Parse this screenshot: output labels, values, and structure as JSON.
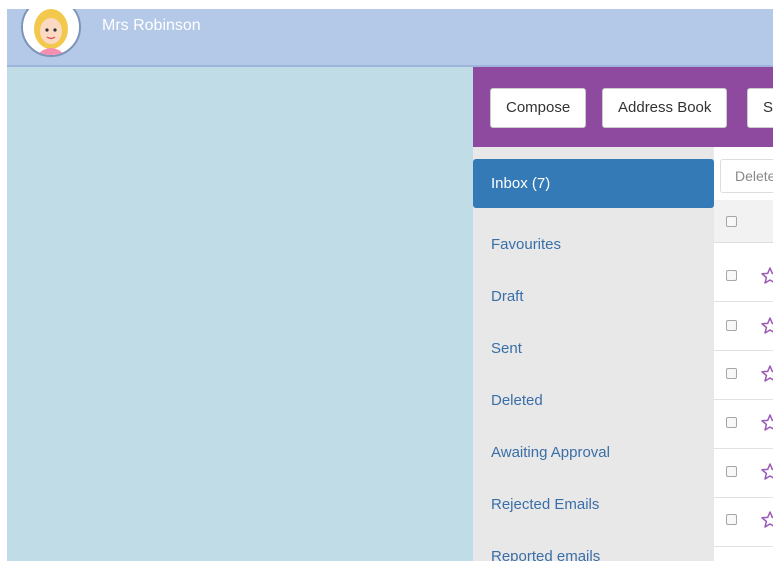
{
  "header": {
    "user_name": "Mrs Robinson"
  },
  "toolbar": {
    "compose_label": "Compose",
    "address_book_label": "Address Book",
    "third_label": "S"
  },
  "sidebar": {
    "items": [
      {
        "label": "Inbox (7)",
        "active": true
      },
      {
        "label": "Favourites",
        "active": false
      },
      {
        "label": "Draft",
        "active": false
      },
      {
        "label": "Sent",
        "active": false
      },
      {
        "label": "Deleted",
        "active": false
      },
      {
        "label": "Awaiting Approval",
        "active": false
      },
      {
        "label": "Rejected Emails",
        "active": false
      },
      {
        "label": "Reported emails",
        "active": false
      }
    ]
  },
  "message_list": {
    "delete_label": "Delete"
  },
  "colors": {
    "header_bg": "#b4c8e8",
    "page_bg": "#c0dce6",
    "toolbar_bg": "#8e4a9e",
    "active_nav": "#337ab7",
    "nav_link": "#3a6ea8",
    "star": "#9b59b6"
  },
  "icons": {
    "avatar": "user-avatar",
    "star": "star-outline-icon"
  }
}
